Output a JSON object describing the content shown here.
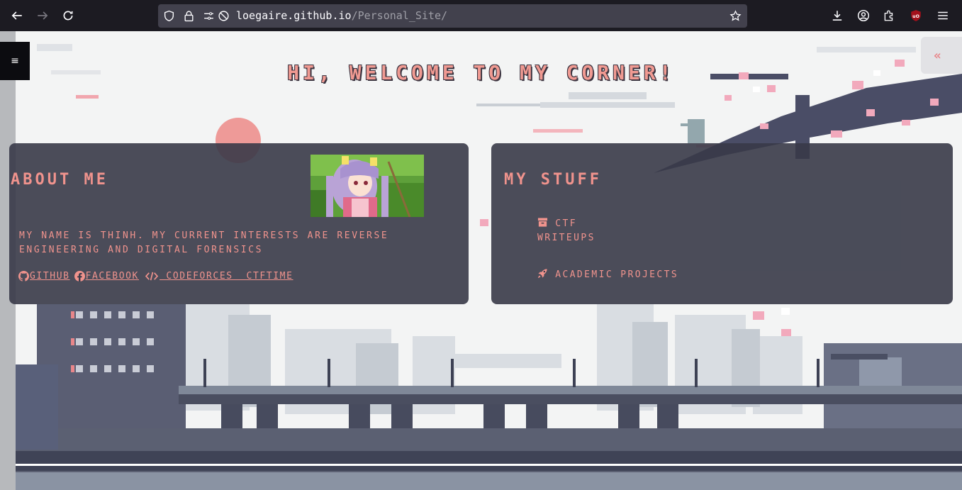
{
  "browser": {
    "url_host": "loegaire.github.io",
    "url_path": "/Personal_Site/"
  },
  "page": {
    "title": "Hi, welcome to my corner!",
    "menu_icon": "hamburger-icon",
    "corner_button_label": "«"
  },
  "about": {
    "heading": "About me",
    "text": "My name is Thinh. My current interests are reverse engineering and digital forensics",
    "links": [
      {
        "label": "Github",
        "icon": "github-icon"
      },
      {
        "label": "Facebook",
        "icon": "facebook-icon"
      },
      {
        "label": " Codeforces  CTFtime",
        "icon": "code-icon"
      }
    ]
  },
  "stuff": {
    "heading": "My Stuff",
    "items": [
      {
        "label_line1": "CTF",
        "label_line2": "Writeups",
        "icon": "archive-icon"
      },
      {
        "label_line1": "Academic projects",
        "icon": "rocket-icon"
      }
    ]
  },
  "colors": {
    "accent": "#f0938d",
    "card": "#383a48",
    "page_bg": "#f3f4f4"
  }
}
